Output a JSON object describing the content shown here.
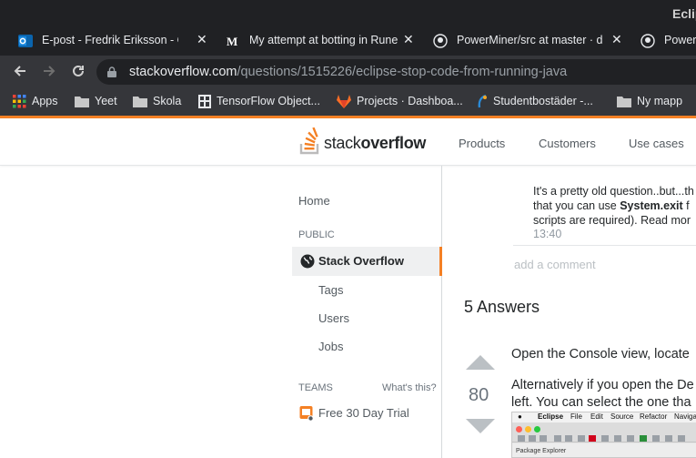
{
  "window": {
    "title": "Eclip"
  },
  "tabs": [
    {
      "title": "E-post - Fredrik Eriksson - Out",
      "icon": "outlook-icon"
    },
    {
      "title": "My attempt at botting in Rune",
      "icon": "medium-icon"
    },
    {
      "title": "PowerMiner/src at master · d",
      "icon": "github-icon"
    },
    {
      "title": "Power",
      "icon": "github-icon"
    }
  ],
  "address": {
    "domain": "stackoverflow.com",
    "path": "/questions/1515226/eclipse-stop-code-from-running-java"
  },
  "bookmarks": [
    {
      "label": "Apps",
      "icon": "apps-grid-icon"
    },
    {
      "label": "Yeet",
      "icon": "folder-icon"
    },
    {
      "label": "Skola",
      "icon": "folder-icon"
    },
    {
      "label": "TensorFlow Object...",
      "icon": "tensorflow-icon"
    },
    {
      "label": "Projects · Dashboa...",
      "icon": "gitlab-icon"
    },
    {
      "label": "Studentbostäder -...",
      "icon": "studentbostader-icon"
    },
    {
      "label": "Ny mapp",
      "icon": "folder-icon"
    }
  ],
  "so": {
    "logo_light": "stack",
    "logo_bold": "overflow",
    "nav": [
      "Products",
      "Customers",
      "Use cases"
    ]
  },
  "leftnav": {
    "home": "Home",
    "public": "PUBLIC",
    "stack_overflow": "Stack Overflow",
    "tags": "Tags",
    "users": "Users",
    "jobs": "Jobs",
    "teams": "TEAMS",
    "whats_this": "What's this?",
    "free_trial": "Free 30 Day Trial"
  },
  "comment": {
    "line1": "It's a pretty old question..but...th",
    "line2_pre": "that you can use ",
    "line2_bold": "System.exit",
    "line2_post": " f",
    "line3": "scripts are required). Read mor",
    "time": "13:40",
    "add": "add a comment"
  },
  "answers": {
    "heading": "5 Answers",
    "votes": "80",
    "line1": "Open the Console view, locate",
    "line2": "Alternatively if you open the De",
    "line3": "left. You can select the one tha"
  },
  "screenshot": {
    "menus": [
      "Eclipse",
      "File",
      "Edit",
      "Source",
      "Refactor",
      "Navigat"
    ],
    "lower": "Package Explorer"
  },
  "colors": {
    "chrome_dark": "#202124",
    "chrome_bar": "#35363a",
    "so_orange": "#f48024",
    "link_gray": "#535a60"
  }
}
